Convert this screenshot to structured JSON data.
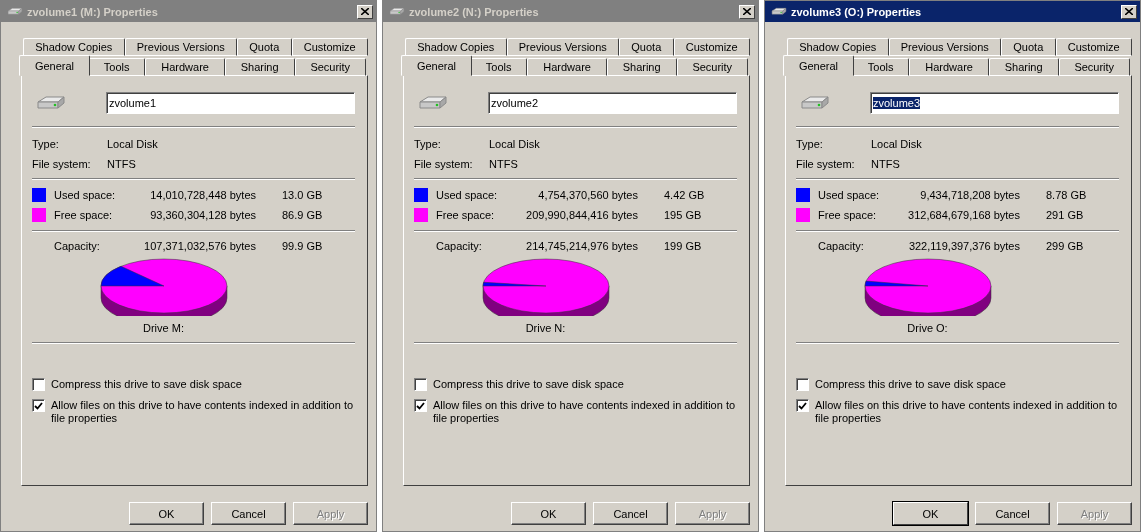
{
  "windows": [
    {
      "title": "zvolume1 (M:) Properties",
      "active": false,
      "tab_rows": [
        [
          {
            "label": "Shadow Copies",
            "selected": false
          },
          {
            "label": "Previous Versions",
            "selected": false
          },
          {
            "label": "Quota",
            "selected": false
          },
          {
            "label": "Customize",
            "selected": false
          }
        ],
        [
          {
            "label": "General",
            "selected": true
          },
          {
            "label": "Tools",
            "selected": false
          },
          {
            "label": "Hardware",
            "selected": false
          },
          {
            "label": "Sharing",
            "selected": false
          },
          {
            "label": "Security",
            "selected": false
          }
        ]
      ],
      "name": {
        "value": "zvolume1",
        "text_selected": false
      },
      "info": [
        {
          "label": "Type:",
          "value": "Local Disk"
        },
        {
          "label": "File system:",
          "value": "NTFS"
        }
      ],
      "space": [
        {
          "label": "Used space:",
          "bytes": "14,010,728,448 bytes",
          "size": "13.0 GB",
          "color": "#0000ff"
        },
        {
          "label": "Free space:",
          "bytes": "93,360,304,128 bytes",
          "size": "86.9 GB",
          "color": "#ff00ff"
        }
      ],
      "capacity": {
        "label": "Capacity:",
        "bytes": "107,371,032,576 bytes",
        "size": "99.9 GB"
      },
      "drive_label": "Drive M:",
      "options": [
        {
          "label": "Compress this drive to save disk space",
          "checked": false
        },
        {
          "label": "Allow files on this drive to have contents indexed in addition to file properties",
          "checked": true
        }
      ],
      "buttons": [
        {
          "label": "OK",
          "disabled": false,
          "default": false
        },
        {
          "label": "Cancel",
          "disabled": false,
          "default": false
        },
        {
          "label": "Apply",
          "disabled": true,
          "default": false
        }
      ]
    },
    {
      "title": "zvolume2 (N:) Properties",
      "active": false,
      "tab_rows": [
        [
          {
            "label": "Shadow Copies",
            "selected": false
          },
          {
            "label": "Previous Versions",
            "selected": false
          },
          {
            "label": "Quota",
            "selected": false
          },
          {
            "label": "Customize",
            "selected": false
          }
        ],
        [
          {
            "label": "General",
            "selected": true
          },
          {
            "label": "Tools",
            "selected": false
          },
          {
            "label": "Hardware",
            "selected": false
          },
          {
            "label": "Sharing",
            "selected": false
          },
          {
            "label": "Security",
            "selected": false
          }
        ]
      ],
      "name": {
        "value": "zvolume2",
        "text_selected": false
      },
      "info": [
        {
          "label": "Type:",
          "value": "Local Disk"
        },
        {
          "label": "File system:",
          "value": "NTFS"
        }
      ],
      "space": [
        {
          "label": "Used space:",
          "bytes": "4,754,370,560 bytes",
          "size": "4.42 GB",
          "color": "#0000ff"
        },
        {
          "label": "Free space:",
          "bytes": "209,990,844,416 bytes",
          "size": "195 GB",
          "color": "#ff00ff"
        }
      ],
      "capacity": {
        "label": "Capacity:",
        "bytes": "214,745,214,976 bytes",
        "size": "199 GB"
      },
      "drive_label": "Drive N:",
      "options": [
        {
          "label": "Compress this drive to save disk space",
          "checked": false
        },
        {
          "label": "Allow files on this drive to have contents indexed in addition to file properties",
          "checked": true
        }
      ],
      "buttons": [
        {
          "label": "OK",
          "disabled": false,
          "default": false
        },
        {
          "label": "Cancel",
          "disabled": false,
          "default": false
        },
        {
          "label": "Apply",
          "disabled": true,
          "default": false
        }
      ]
    },
    {
      "title": "zvolume3 (O:) Properties",
      "active": true,
      "tab_rows": [
        [
          {
            "label": "Shadow Copies",
            "selected": false
          },
          {
            "label": "Previous Versions",
            "selected": false
          },
          {
            "label": "Quota",
            "selected": false
          },
          {
            "label": "Customize",
            "selected": false
          }
        ],
        [
          {
            "label": "General",
            "selected": true
          },
          {
            "label": "Tools",
            "selected": false
          },
          {
            "label": "Hardware",
            "selected": false
          },
          {
            "label": "Sharing",
            "selected": false
          },
          {
            "label": "Security",
            "selected": false
          }
        ]
      ],
      "name": {
        "value": "zvolume3",
        "text_selected": true
      },
      "info": [
        {
          "label": "Type:",
          "value": "Local Disk"
        },
        {
          "label": "File system:",
          "value": "NTFS"
        }
      ],
      "space": [
        {
          "label": "Used space:",
          "bytes": "9,434,718,208 bytes",
          "size": "8.78 GB",
          "color": "#0000ff"
        },
        {
          "label": "Free space:",
          "bytes": "312,684,679,168 bytes",
          "size": "291 GB",
          "color": "#ff00ff"
        }
      ],
      "capacity": {
        "label": "Capacity:",
        "bytes": "322,119,397,376 bytes",
        "size": "299 GB"
      },
      "drive_label": "Drive O:",
      "options": [
        {
          "label": "Compress this drive to save disk space",
          "checked": false
        },
        {
          "label": "Allow files on this drive to have contents indexed in addition to file properties",
          "checked": true
        }
      ],
      "buttons": [
        {
          "label": "OK",
          "disabled": false,
          "default": true
        },
        {
          "label": "Cancel",
          "disabled": false,
          "default": false
        },
        {
          "label": "Apply",
          "disabled": true,
          "default": false
        }
      ]
    }
  ]
}
